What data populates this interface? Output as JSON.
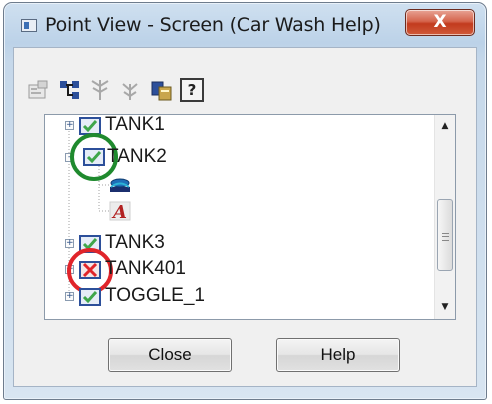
{
  "window": {
    "title": "Point View - Screen (Car Wash Help)",
    "close_label": "X"
  },
  "toolbar": {
    "items": [
      {
        "icon": "properties-icon"
      },
      {
        "icon": "tree-structure-icon"
      },
      {
        "icon": "tree-expand-icon"
      },
      {
        "icon": "tree-collapse-icon"
      },
      {
        "icon": "copy-icon"
      },
      {
        "icon": "help-icon",
        "label": "?"
      }
    ]
  },
  "tree": {
    "nodes": [
      {
        "label": "TANK1",
        "state": "checked",
        "expander": "+"
      },
      {
        "label": "TANK2",
        "state": "checked",
        "expander": "-",
        "highlight": "#1f8a2e"
      },
      {
        "label": "",
        "icon": "database-point-icon"
      },
      {
        "label": "",
        "icon": "text-object-icon"
      },
      {
        "label": "TANK3",
        "state": "checked",
        "expander": "+"
      },
      {
        "label": "TANK401",
        "state": "error",
        "expander": "+",
        "highlight": "#e0242a"
      },
      {
        "label": "TOGGLE_1",
        "state": "checked",
        "expander": "+"
      }
    ]
  },
  "buttons": {
    "close": "Close",
    "help": "Help"
  },
  "colors": {
    "check_green": "#3fa64a",
    "error_red": "#e0242a",
    "accent_blue": "#2c4f9a"
  }
}
